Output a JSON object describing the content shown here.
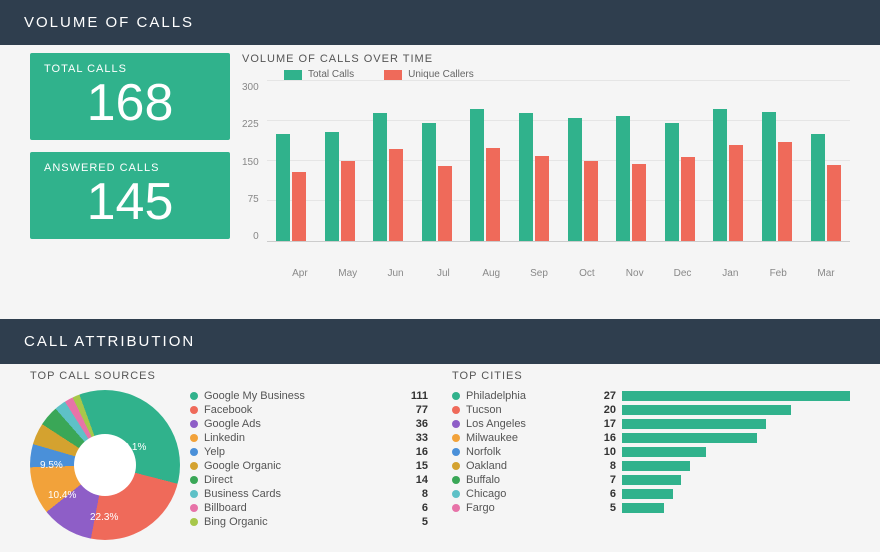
{
  "colors": {
    "teal": "#30b28c",
    "red": "#ef6a5a",
    "purple": "#8e5ec7",
    "orange": "#f2a23a",
    "blue": "#4a90d9",
    "gold": "#d4a22f",
    "green": "#3aa757",
    "cyan": "#5ec1c7",
    "pink": "#e773a8",
    "lime": "#a7c74a"
  },
  "sections": {
    "volume_title": "VOLUME OF CALLS",
    "attribution_title": "CALL ATTRIBUTION"
  },
  "kpis": {
    "total_label": "TOTAL CALLS",
    "total_value": "168",
    "answered_label": "ANSWERED CALLS",
    "answered_value": "145"
  },
  "volume_chart_title": "VOLUME OF CALLS OVER TIME",
  "chart_data": [
    {
      "type": "bar",
      "title": "VOLUME OF CALLS OVER TIME",
      "categories": [
        "Apr",
        "May",
        "Jun",
        "Jul",
        "Aug",
        "Sep",
        "Oct",
        "Nov",
        "Dec",
        "Jan",
        "Feb",
        "Mar"
      ],
      "series": [
        {
          "name": "Total Calls",
          "color": "#30b28c",
          "values": [
            200,
            205,
            240,
            222,
            248,
            240,
            230,
            235,
            222,
            248,
            242,
            200
          ]
        },
        {
          "name": "Unique Callers",
          "color": "#ef6a5a",
          "values": [
            130,
            150,
            172,
            140,
            175,
            160,
            150,
            145,
            158,
            180,
            185,
            142
          ]
        }
      ],
      "ylabel": "",
      "xlabel": "",
      "ylim": [
        0,
        300
      ],
      "yticks": [
        0,
        75,
        150,
        225,
        300
      ]
    },
    {
      "type": "pie",
      "title": "TOP CALL SOURCES",
      "slices": [
        {
          "name": "Google My Business",
          "value": 111,
          "pct": 32.1,
          "color": "#30b28c"
        },
        {
          "name": "Facebook",
          "value": 77,
          "pct": 22.3,
          "color": "#ef6a5a"
        },
        {
          "name": "Google Ads",
          "value": 36,
          "pct": 10.4,
          "color": "#8e5ec7"
        },
        {
          "name": "Linkedin",
          "value": 33,
          "pct": 9.5,
          "color": "#f2a23a"
        },
        {
          "name": "Yelp",
          "value": 16,
          "color": "#4a90d9"
        },
        {
          "name": "Google Organic",
          "value": 15,
          "color": "#d4a22f"
        },
        {
          "name": "Direct",
          "value": 14,
          "color": "#3aa757"
        },
        {
          "name": "Business Cards",
          "value": 8,
          "color": "#5ec1c7"
        },
        {
          "name": "Billboard",
          "value": 6,
          "color": "#e773a8"
        },
        {
          "name": "Bing Organic",
          "value": 5,
          "color": "#a7c74a"
        }
      ]
    },
    {
      "type": "bar",
      "title": "TOP CITIES",
      "orientation": "horizontal",
      "categories": [
        "Philadelphia",
        "Tucson",
        "Los Angeles",
        "Milwaukee",
        "Norfolk",
        "Oakland",
        "Buffalo",
        "Chicago",
        "Fargo"
      ],
      "values": [
        27,
        20,
        17,
        16,
        10,
        8,
        7,
        6,
        5
      ],
      "colors": [
        "#30b28c",
        "#ef6a5a",
        "#8e5ec7",
        "#f2a23a",
        "#4a90d9",
        "#d4a22f",
        "#3aa757",
        "#5ec1c7",
        "#e773a8"
      ]
    }
  ],
  "sources_title": "TOP CALL SOURCES",
  "cities_title": "TOP CITIES",
  "donut_labels": {
    "a": "32.1%",
    "b": "22.3%",
    "c": "10.4%",
    "d": "9.5%"
  }
}
